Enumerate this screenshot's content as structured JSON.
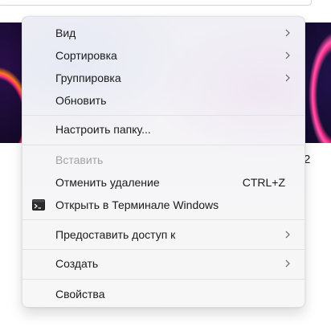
{
  "menu": {
    "items": [
      {
        "label": "Вид",
        "submenu": true
      },
      {
        "label": "Сортировка",
        "submenu": true
      },
      {
        "label": "Группировка",
        "submenu": true
      },
      {
        "label": "Обновить"
      },
      {
        "label": "Настроить папку..."
      },
      {
        "label": "Вставить",
        "disabled": true
      },
      {
        "label": "Отменить удаление",
        "shortcut": "CTRL+Z"
      },
      {
        "label": "Открыть в Терминале Windows",
        "icon": "terminal-icon"
      },
      {
        "label": "Предоставить доступ к",
        "submenu": true
      },
      {
        "label": "Создать",
        "submenu": true
      },
      {
        "label": "Свойства"
      }
    ]
  },
  "background": {
    "partial_text": "2"
  }
}
